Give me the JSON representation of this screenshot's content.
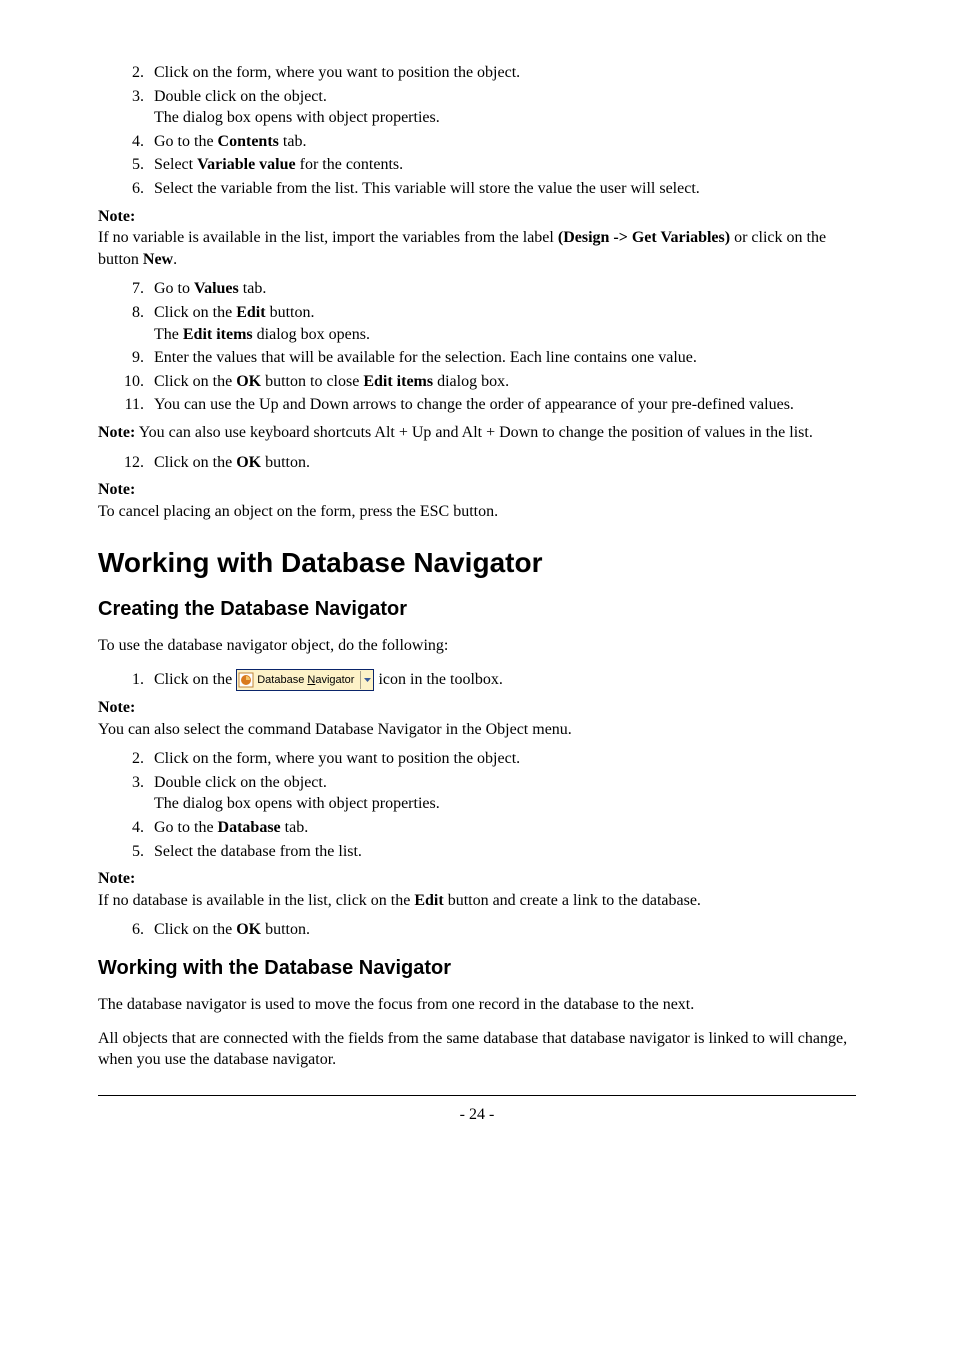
{
  "listA": [
    {
      "n": "2.",
      "text": "Click on the form, where you want to position the object."
    },
    {
      "n": "3.",
      "text": "Double click on the object.",
      "sub": "The dialog box opens with object properties."
    },
    {
      "n": "4.",
      "pre": "Go to the ",
      "bold": "Contents",
      "post": " tab."
    },
    {
      "n": "5.",
      "pre": "Select ",
      "bold": "Variable value",
      "post": " for the contents."
    },
    {
      "n": "6.",
      "text": "Select the variable from the list. This variable will store the value the user will select."
    }
  ],
  "note1": {
    "label": "Note:",
    "pre": "If no variable is available in the list, import the variables from the label ",
    "bold1": "(Design -> Get Variables)",
    "mid": " or click on the button ",
    "bold2": "New",
    "post": "."
  },
  "listB": [
    {
      "n": "7.",
      "pre": "Go to ",
      "bold": "Values",
      "post": " tab."
    },
    {
      "n": "8.",
      "pre": "Click on the ",
      "bold": "Edit",
      "post": " button.",
      "sub_pre": "The ",
      "sub_bold": "Edit items",
      "sub_post": " dialog box opens."
    },
    {
      "n": "9.",
      "text": "Enter the values that will be available for the selection. Each line contains one value."
    },
    {
      "n": "10.",
      "pre": "Click on the ",
      "bold": "OK",
      "post": " button to close ",
      "bold2": "Edit items",
      "post2": " dialog box."
    },
    {
      "n": "11.",
      "text": "You can use the Up and Down arrows to change the order of appearance of your pre-defined values."
    }
  ],
  "note2": {
    "label": "Note:",
    "text": " You can also use keyboard shortcuts Alt + Up and Alt + Down to change the position of values in the list."
  },
  "listC": [
    {
      "n": "12.",
      "pre": "Click on the ",
      "bold": "OK",
      "post": " button."
    }
  ],
  "note3": {
    "label": "Note:",
    "text": "To cancel placing an object on the form, press the ESC button."
  },
  "h1": "Working with Database Navigator",
  "h2a": "Creating the Database Navigator",
  "p1": "To use the database navigator object, do the following:",
  "listD": {
    "n": "1.",
    "pre": "Click on the ",
    "btn_label_pre": "Database ",
    "btn_label_u": "N",
    "btn_label_post": "avigator",
    "post": " icon in the toolbox."
  },
  "note4": {
    "label": "Note:",
    "text": " You can also select the command Database Navigator in the Object menu."
  },
  "listE": [
    {
      "n": "2.",
      "text": "Click on the form, where you want to position the object."
    },
    {
      "n": "3.",
      "text": "Double click on the object.",
      "sub": " The dialog box opens with object properties."
    },
    {
      "n": "4.",
      "pre": "Go to the ",
      "bold": "Database",
      "post": " tab."
    },
    {
      "n": "5.",
      "text": "Select the database from the list."
    }
  ],
  "note5": {
    "label": "Note:",
    "pre": " If no database is available in the list, click on the ",
    "bold": "Edit",
    "post": " button and create a link to the database."
  },
  "listF": [
    {
      "n": "6.",
      "pre": "Click on the ",
      "bold": "OK",
      "post": " button."
    }
  ],
  "h2b": "Working with the Database Navigator",
  "p2": "The database navigator is used to move the focus from one record in the database to the next.",
  "p3": "All objects that are connected with the fields from the same database that database navigator is linked to will change, when you use the database navigator.",
  "pagenum": "- 24 -"
}
